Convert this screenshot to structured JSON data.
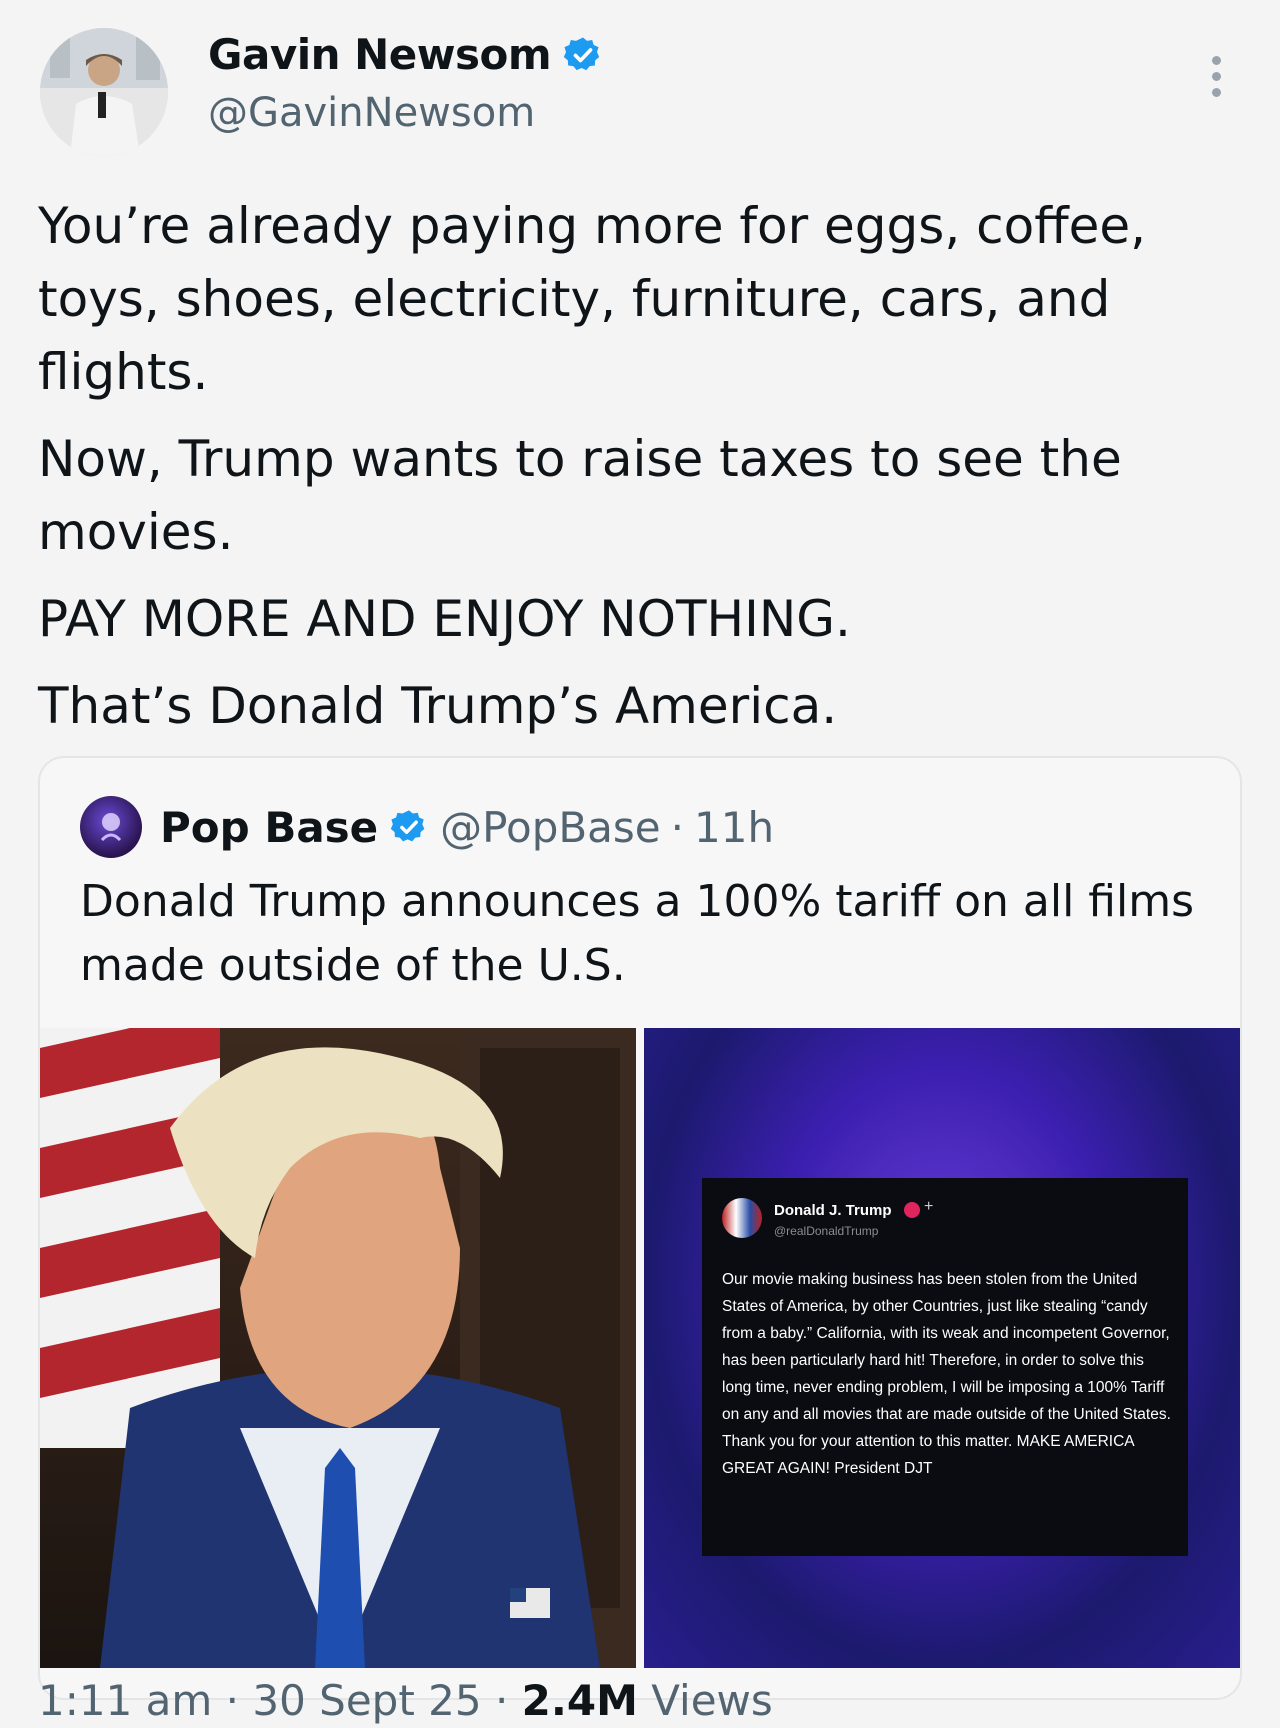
{
  "author": {
    "display_name": "Gavin Newsom",
    "handle": "@GavinNewsom",
    "verified_icon": "verified-badge-icon"
  },
  "tweet": {
    "lines": [
      "You’re already paying more for eggs, coffee, toys, shoes, electricity, furniture, cars, and flights.",
      "Now, Trump wants to raise taxes to see the movies.",
      "PAY MORE AND ENJOY NOTHING.",
      "That’s Donald Trump’s America."
    ]
  },
  "quoted": {
    "display_name": "Pop Base",
    "handle": "@PopBase",
    "separator": "·",
    "time": "11h",
    "text": "Donald Trump announces a 100% tariff on all films made outside of the U.S.",
    "embedded_post": {
      "name": "Donald J. Trump",
      "handle": "@realDonaldTrump",
      "plus": "+",
      "body": "Our movie making business has been stolen from the United States of America, by other Countries, just like stealing “candy from a baby.” California, with its weak and incompetent Governor, has been particularly hard hit! Therefore, in order to solve this long time, never ending problem, I will be imposing a 100% Tariff on any and all movies that are made outside of the United States. Thank you for your attention to this matter. MAKE AMERICA GREAT AGAIN! President DJT"
    }
  },
  "meta": {
    "time": "1:11 am",
    "sep1": " · ",
    "date": "30 Sept 25",
    "sep2": " · ",
    "views_count": "2.4M",
    "views_label": " Views"
  },
  "colors": {
    "verified_blue": "#1d9bf0",
    "text_primary": "#0f1419",
    "text_secondary": "#536471"
  }
}
